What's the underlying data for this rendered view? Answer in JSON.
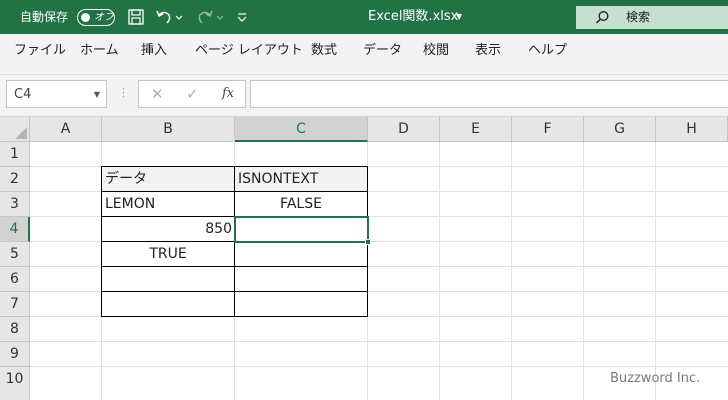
{
  "titlebar": {
    "autosave_label": "自動保存",
    "autosave_state": "オフ",
    "icons": [
      "save-icon",
      "undo-icon",
      "redo-icon",
      "customize-icon"
    ],
    "file_title": "Excel関数.xlsx",
    "search_label": "検索"
  },
  "menu": [
    "ファイル",
    "ホーム",
    "挿入",
    "ページ レイアウト",
    "数式",
    "データ",
    "校閲",
    "表示",
    "ヘルプ"
  ],
  "formula_bar": {
    "name_box": "C4",
    "fx_label": "fx",
    "formula": ""
  },
  "sheet": {
    "columns": [
      "A",
      "B",
      "C",
      "D",
      "E",
      "F",
      "G",
      "H"
    ],
    "rows": [
      "1",
      "2",
      "3",
      "4",
      "5",
      "6",
      "7",
      "8",
      "9",
      "10"
    ],
    "selected_column": "C",
    "selected_row": "4",
    "cells": {
      "B2": "データ",
      "C2": "ISNONTEXT",
      "B3": "LEMON",
      "C3": "FALSE",
      "B4": "850",
      "B5": "TRUE"
    }
  },
  "watermark": "Buzzword Inc.",
  "colors": {
    "accent": "#217346",
    "header_fill": "#f2f2f2",
    "search_box": "#c6e0d0"
  }
}
